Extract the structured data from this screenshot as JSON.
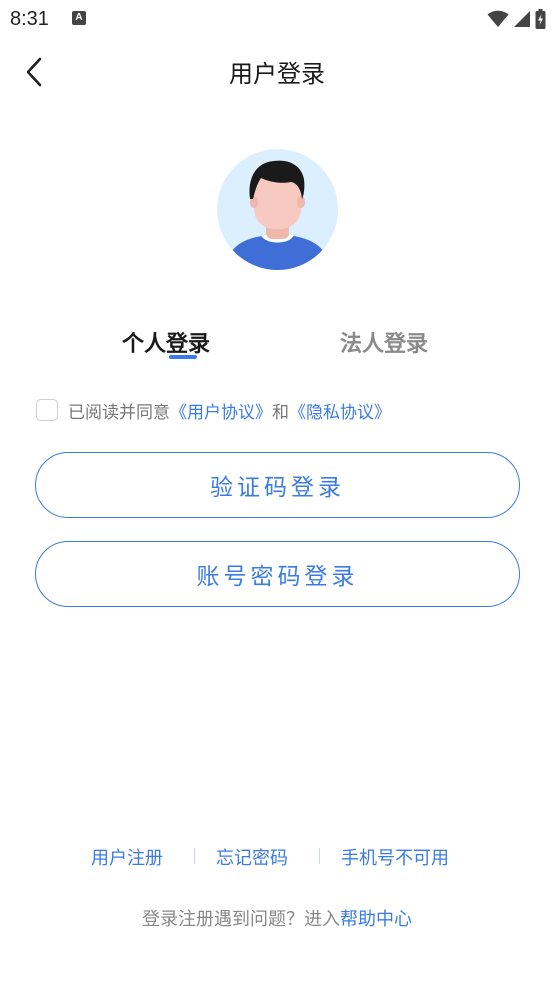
{
  "status_bar": {
    "time": "8:31",
    "notification_icon_letter": "A"
  },
  "nav": {
    "title": "用户登录",
    "back_icon": "chevron-left-icon"
  },
  "tabs": {
    "personal": "个人登录",
    "legal": "法人登录",
    "active": "personal"
  },
  "agreement": {
    "checked": false,
    "prefix": "已阅读并同意",
    "user_agreement": "《用户协议》",
    "and": "和",
    "privacy_policy": "《隐私协议》"
  },
  "buttons": {
    "sms_login": "验证码登录",
    "password_login": "账号密码登录"
  },
  "footer": {
    "register": "用户注册",
    "forgot_password": "忘记密码",
    "phone_unavailable": "手机号不可用",
    "help_prefix": "登录注册遇到问题？进入",
    "help_center": "帮助中心"
  },
  "colors": {
    "accent": "#3b7be6",
    "muted_text": "#888888",
    "avatar_bg": "#dcefff",
    "avatar_shirt": "#3f6fd6"
  }
}
